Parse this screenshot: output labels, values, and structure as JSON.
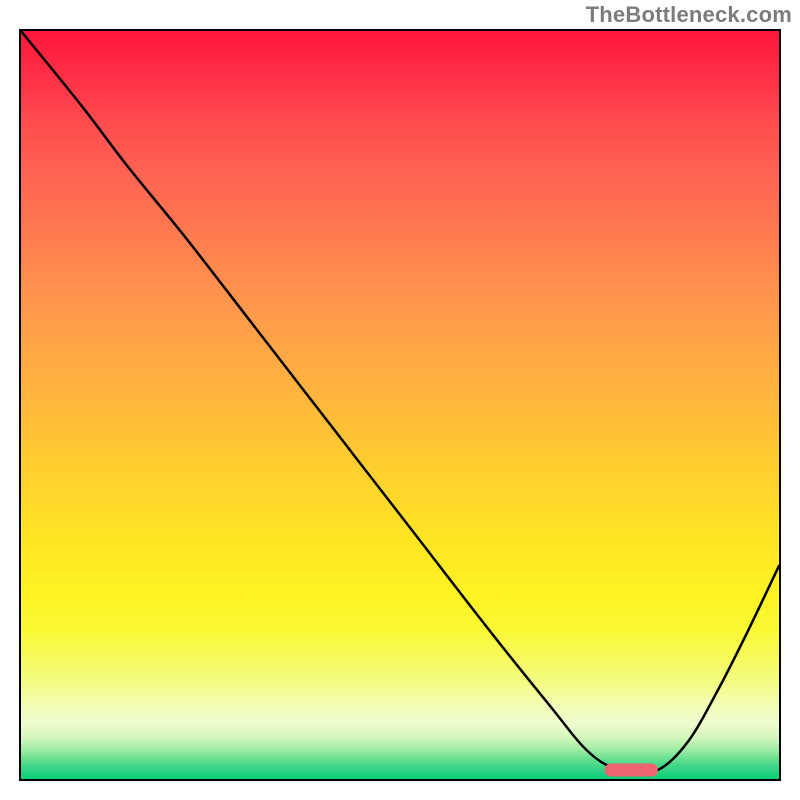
{
  "watermark": "TheBottleneck.com",
  "chart_data": {
    "type": "line",
    "title": "",
    "xlabel": "",
    "ylabel": "",
    "xlim": [
      0,
      100
    ],
    "ylim": [
      0,
      100
    ],
    "series": [
      {
        "name": "bottleneck-curve",
        "x": [
          0,
          8,
          14,
          22,
          32,
          42,
          52,
          62,
          70,
          74,
          77,
          80,
          84,
          88,
          92,
          96,
          100
        ],
        "y": [
          100,
          90,
          82,
          72,
          58.9,
          45.8,
          32.7,
          19.6,
          9.5,
          4.5,
          2.0,
          1.2,
          1.2,
          5.0,
          12.0,
          20.0,
          28.5
        ]
      }
    ],
    "marker": {
      "x_start": 77,
      "x_end": 84,
      "y": 1.2,
      "color": "#ef6471"
    },
    "background_gradient": {
      "top": "#ff173b",
      "mid": "#ffe524",
      "bottom": "#0bcd7a"
    }
  }
}
